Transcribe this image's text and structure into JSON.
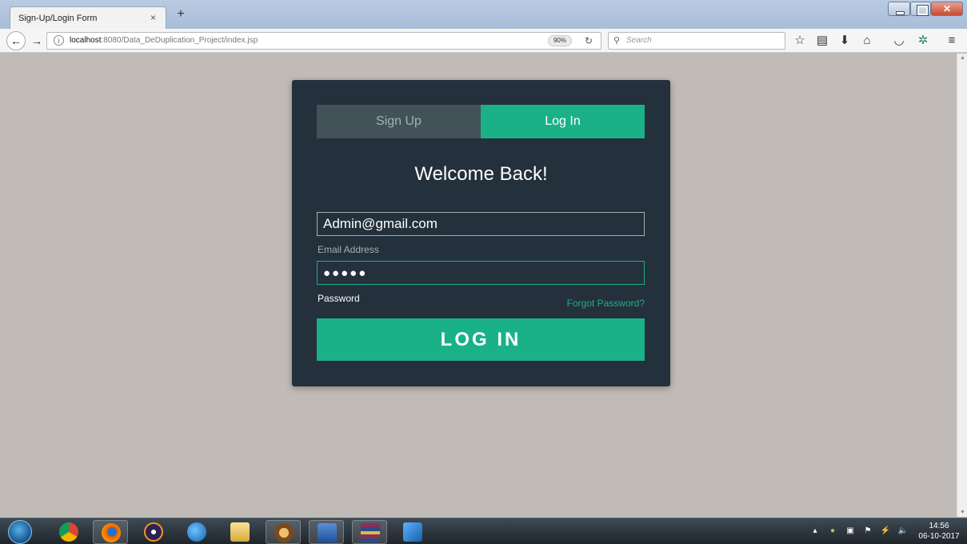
{
  "browser": {
    "tab_title": "Sign-Up/Login Form",
    "tab_close": "×",
    "new_tab": "+",
    "url_host": "localhost",
    "url_path": ":8080/Data_DeDuplication_Project/index.jsp",
    "zoom": "90%",
    "search_placeholder": "Search",
    "icons": [
      "star-icon",
      "reading-list-icon",
      "download-icon",
      "home-icon",
      "pocket-icon",
      "extension-icon",
      "menu-icon"
    ]
  },
  "form": {
    "tab_signup": "Sign Up",
    "tab_login": "Log In",
    "heading": "Welcome Back!",
    "email_value": "Admin@gmail.com",
    "email_label": "Email Address",
    "password_value": "●●●●●",
    "password_label": "Password",
    "forgot_link": "Forgot Password?",
    "submit_label": "LOG IN",
    "colors": {
      "accent": "#1ab188",
      "card": "#24303c",
      "inactive_tab": "#435159"
    }
  },
  "taskbar": {
    "apps": [
      "chrome-icon",
      "firefox-icon",
      "eclipse-icon",
      "media-player-icon",
      "file-explorer-icon",
      "settings-icon",
      "word-icon",
      "archive-icon",
      "flash-icon"
    ],
    "time": "14:56",
    "date": "06-10-2017"
  }
}
